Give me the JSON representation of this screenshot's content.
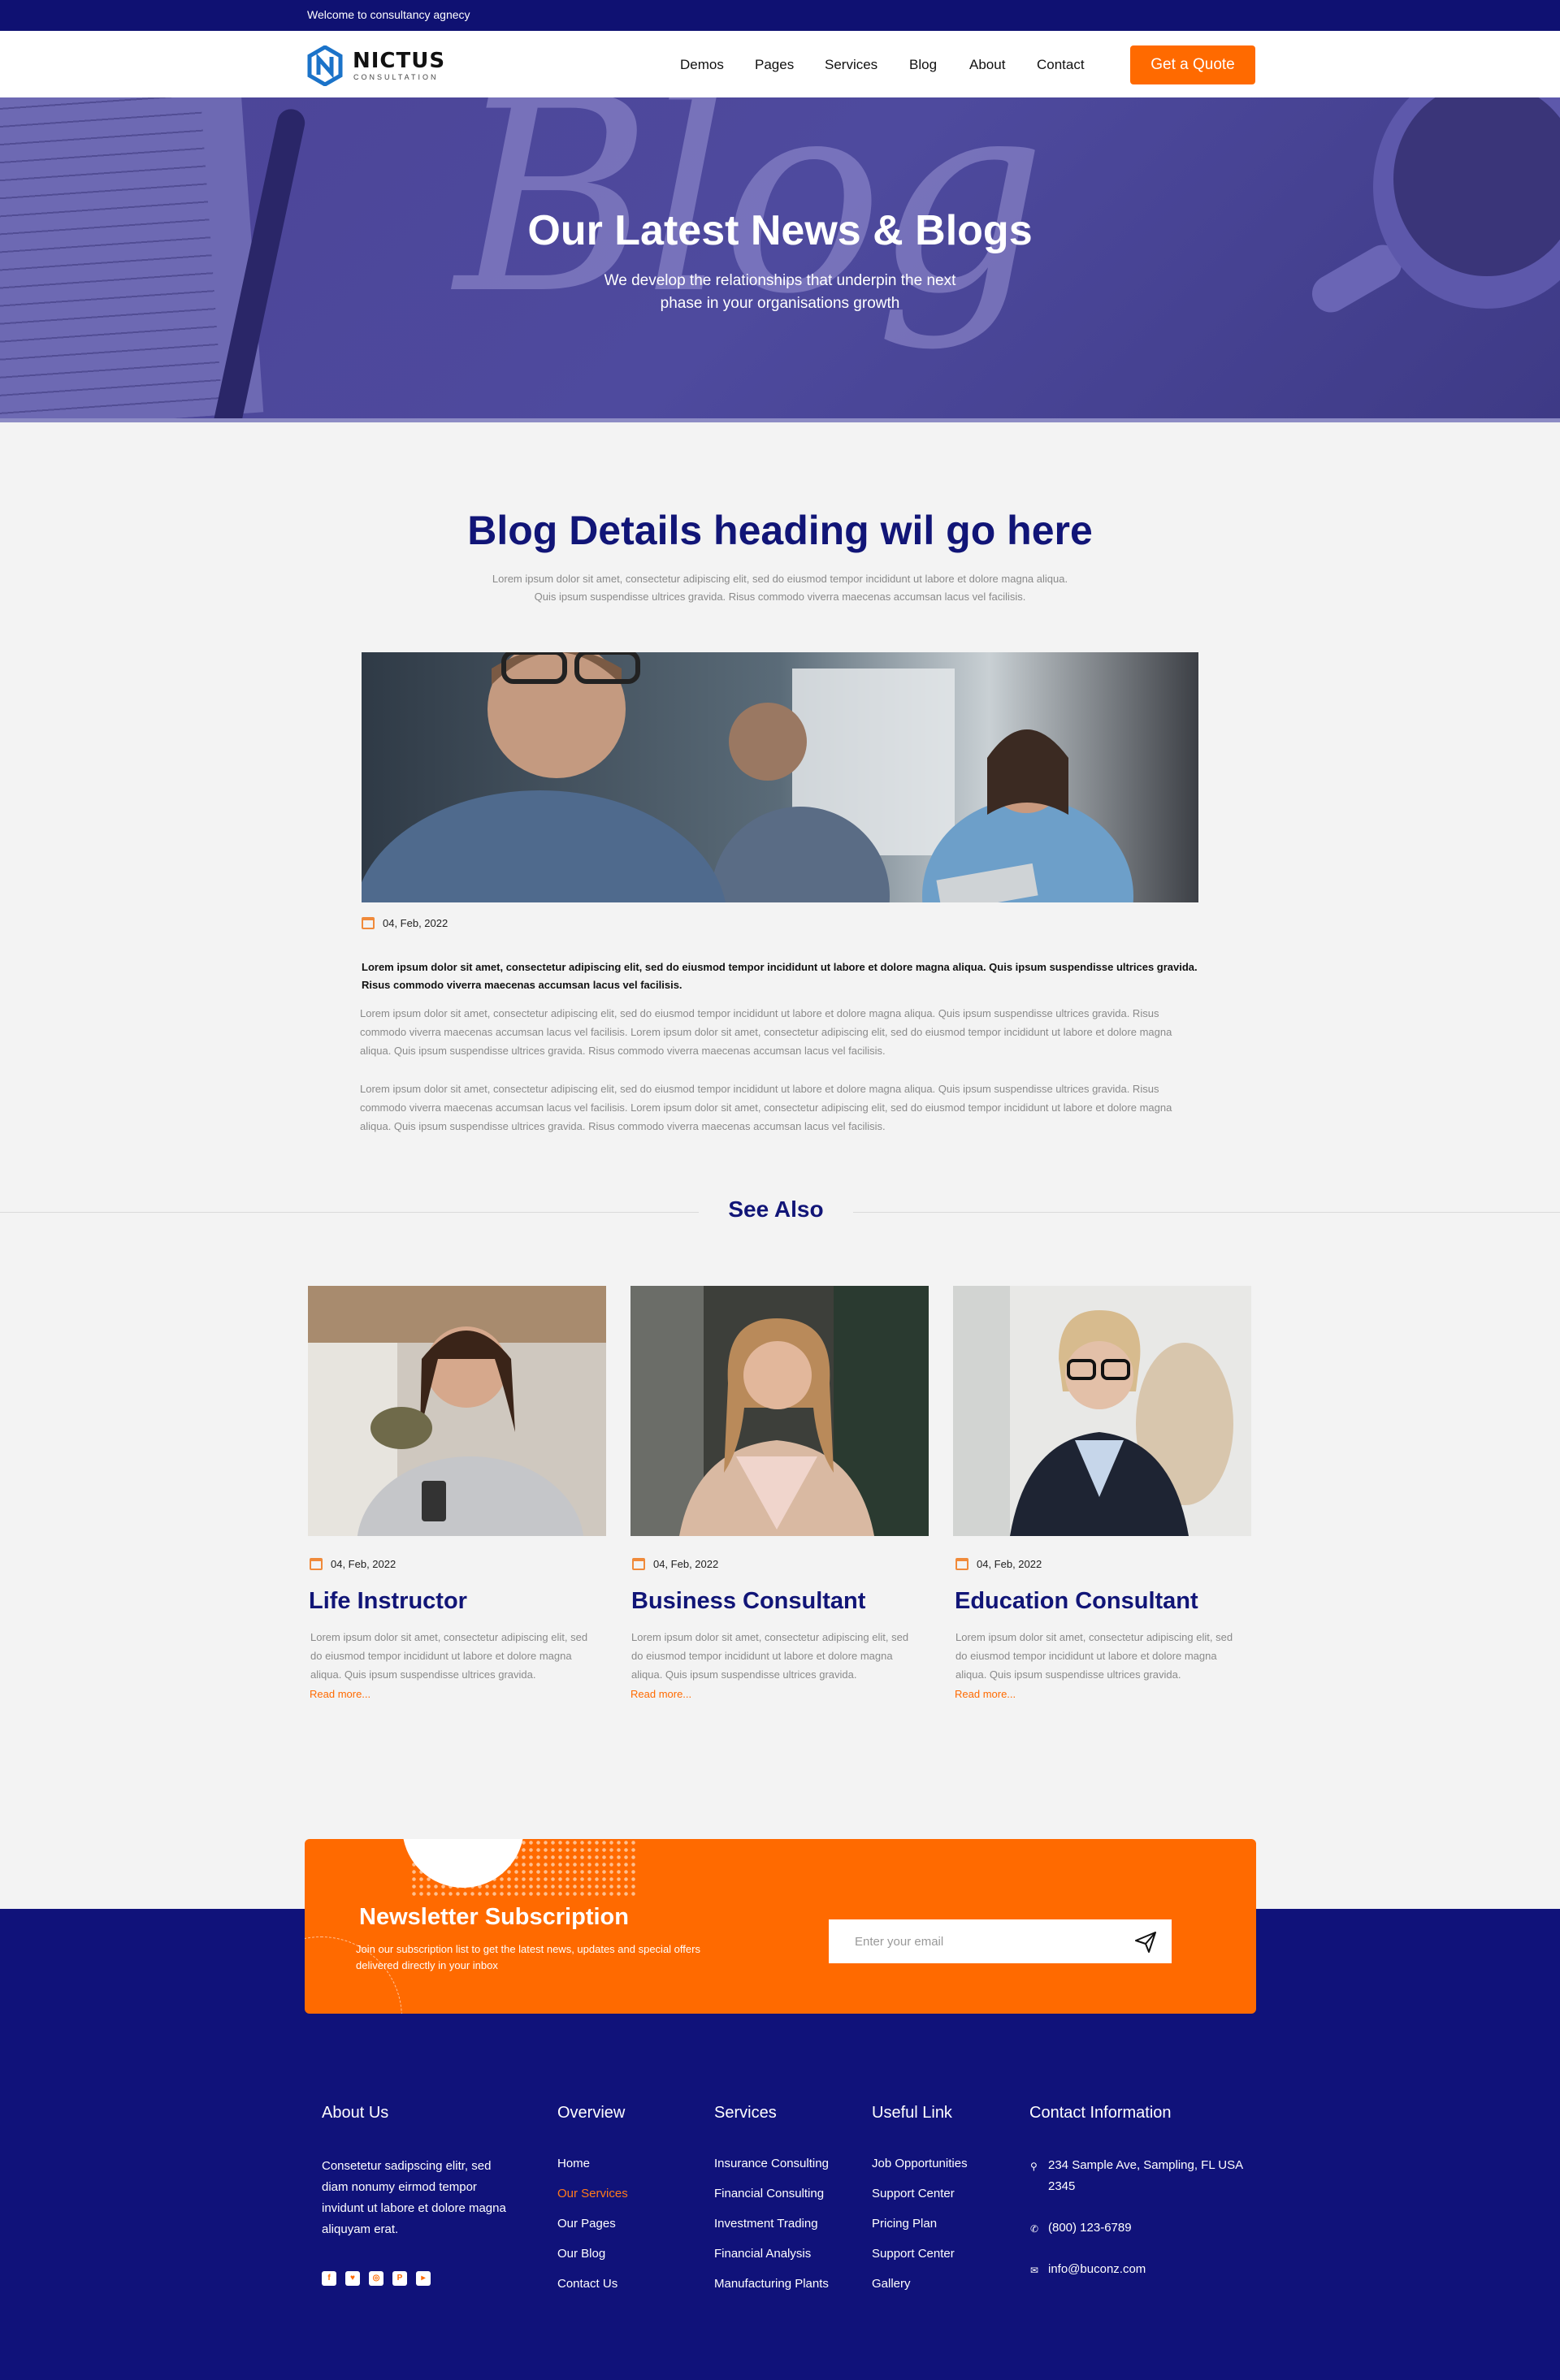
{
  "topbar": {
    "welcome": "Welcome to consultancy agnecy"
  },
  "header": {
    "logo_name": "NICTUS",
    "logo_sub": "CONSULTATION",
    "nav": [
      "Demos",
      "Pages",
      "Services",
      "Blog",
      "About",
      "Contact"
    ],
    "quote_button": "Get a Quote"
  },
  "hero": {
    "title": "Our Latest News & Blogs",
    "subtitle_line1": "We develop the relationships that underpin the next",
    "subtitle_line2": "phase in your organisations growth",
    "script_word": "Blog"
  },
  "blog": {
    "heading": "Blog Details heading wil go here",
    "intro_line1": "Lorem ipsum dolor sit amet, consectetur adipiscing elit, sed do eiusmod tempor incididunt ut labore et dolore magna aliqua.",
    "intro_line2": "Quis ipsum suspendisse ultrices gravida. Risus commodo viverra maecenas accumsan lacus vel facilisis.",
    "date": "04, Feb, 2022",
    "lead": "Lorem ipsum dolor sit amet, consectetur adipiscing elit, sed do eiusmod tempor incididunt ut labore et dolore magna aliqua. Quis ipsum suspendisse ultrices gravida. Risus commodo viverra maecenas accumsan lacus vel facilisis.",
    "paragraph1": "Lorem ipsum dolor sit amet, consectetur adipiscing elit, sed do eiusmod tempor incididunt ut labore et dolore magna aliqua. Quis ipsum suspendisse ultrices gravida. Risus commodo viverra maecenas accumsan lacus vel facilisis.  Lorem ipsum dolor sit amet, consectetur adipiscing elit, sed do eiusmod tempor incididunt ut labore et dolore magna aliqua. Quis ipsum suspendisse ultrices gravida. Risus commodo viverra maecenas accumsan lacus vel facilisis.",
    "paragraph2": "Lorem ipsum dolor sit amet, consectetur adipiscing elit, sed do eiusmod tempor incididunt ut labore et dolore magna aliqua. Quis ipsum suspendisse ultrices gravida. Risus commodo viverra maecenas accumsan lacus vel facilisis.  Lorem ipsum dolor sit amet, consectetur adipiscing elit, sed do eiusmod tempor incididunt ut labore et dolore magna aliqua. Quis ipsum suspendisse ultrices gravida. Risus commodo viverra maecenas accumsan lacus vel facilisis."
  },
  "see_also": {
    "title": "See Also",
    "cards": [
      {
        "date": "04, Feb, 2022",
        "title": "Life Instructor",
        "text": "Lorem ipsum dolor sit amet, consectetur adipiscing elit, sed do eiusmod tempor incididunt ut labore et dolore magna aliqua. Quis ipsum suspendisse ultrices gravida.",
        "more": "Read more..."
      },
      {
        "date": "04, Feb, 2022",
        "title": "Business Consultant",
        "text": "Lorem ipsum dolor sit amet, consectetur adipiscing elit, sed do eiusmod tempor incididunt ut labore et dolore magna aliqua. Quis ipsum suspendisse ultrices gravida.",
        "more": "Read more..."
      },
      {
        "date": "04, Feb, 2022",
        "title": "Education Consultant",
        "text": "Lorem ipsum dolor sit amet, consectetur adipiscing elit, sed do eiusmod tempor incididunt ut labore et dolore magna aliqua. Quis ipsum suspendisse ultrices gravida.",
        "more": "Read more..."
      }
    ]
  },
  "newsletter": {
    "title": "Newsletter Subscription",
    "text": "Join our subscription list to get the latest news, updates and special offers delivered directly in your inbox",
    "placeholder": "Enter your email",
    "send_icon": "paper-plane-icon"
  },
  "footer": {
    "about": {
      "heading": "About Us",
      "text": "Consetetur sadipscing elitr, sed diam nonumy eirmod tempor invidunt ut labore et dolore magna aliquyam erat.",
      "social": [
        "f",
        "♥",
        "◎",
        "P",
        "▸"
      ]
    },
    "overview": {
      "heading": "Overview",
      "links": [
        "Home",
        "Our Services",
        "Our Pages",
        "Our Blog",
        "Contact Us"
      ],
      "active_index": 1
    },
    "services": {
      "heading": "Services",
      "links": [
        "Insurance Consulting",
        "Financial Consulting",
        "Investment Trading",
        "Financial Analysis",
        "Manufacturing Plants"
      ]
    },
    "useful": {
      "heading": "Useful Link",
      "links": [
        "Job Opportunities",
        "Support Center",
        "Pricing Plan",
        "Support Center",
        "Gallery"
      ]
    },
    "contact": {
      "heading": "Contact Information",
      "address": "234 Sample Ave, Sampling, FL USA 2345",
      "phone": "(800) 123-6789",
      "email": "info@buconz.com"
    }
  },
  "colors": {
    "navy": "#10127a",
    "orange": "#ff6a00",
    "hero": "#4c4497"
  }
}
